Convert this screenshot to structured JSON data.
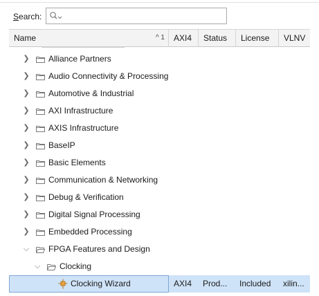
{
  "search": {
    "label_mnemonic": "S",
    "label_rest": "earch:",
    "value": "",
    "placeholder": ""
  },
  "columns": {
    "name": "Name",
    "name_sort": "^ 1",
    "axi4": "AXI4",
    "status": "Status",
    "license": "License",
    "vlnv": "VLNV"
  },
  "tree": {
    "categories": [
      {
        "label": "Alliance Partners",
        "expanded": false
      },
      {
        "label": "Audio Connectivity & Processing",
        "expanded": false
      },
      {
        "label": "Automotive & Industrial",
        "expanded": false
      },
      {
        "label": "AXI Infrastructure",
        "expanded": false
      },
      {
        "label": "AXIS Infrastructure",
        "expanded": false
      },
      {
        "label": "BaseIP",
        "expanded": false
      },
      {
        "label": "Basic Elements",
        "expanded": false
      },
      {
        "label": "Communication & Networking",
        "expanded": false
      },
      {
        "label": "Debug & Verification",
        "expanded": false
      },
      {
        "label": "Digital Signal Processing",
        "expanded": false
      },
      {
        "label": "Embedded Processing",
        "expanded": false
      },
      {
        "label": "FPGA Features and Design",
        "expanded": true
      }
    ],
    "subcategory": {
      "label": "Clocking",
      "expanded": true
    },
    "ip": {
      "label": "Clocking Wizard",
      "axi4": "AXI4",
      "status": "Prod...",
      "license": "Included",
      "vlnv": "xilin...",
      "selected": true
    }
  },
  "icons": {
    "search": "search-icon",
    "folder": "folder-icon",
    "ip": "ip-core-icon",
    "collapsed": "chevron-right-icon",
    "expanded": "chevron-down-icon"
  },
  "colors": {
    "selection": "#cfe3f8",
    "selection_border": "#7ea6d3",
    "header_bg": "#f3f3f3",
    "ip_icon": "#e8a33a"
  }
}
